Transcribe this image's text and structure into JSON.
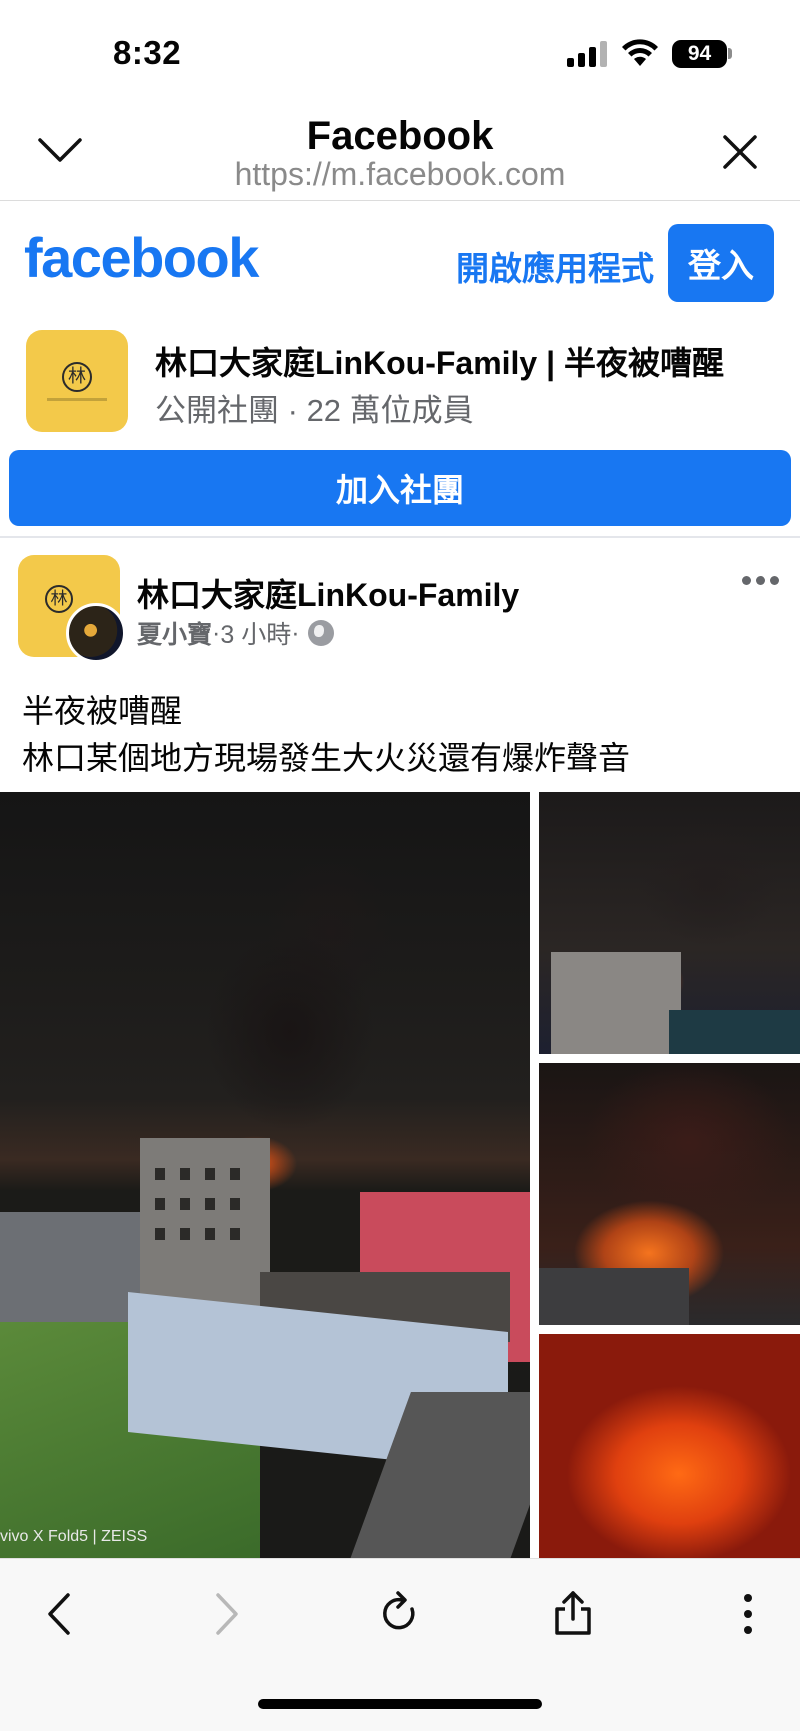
{
  "status_bar": {
    "time": "8:32",
    "battery": "94"
  },
  "browser": {
    "title": "Facebook",
    "url": "https://m.facebook.com",
    "collapse_icon": "chevron-down-icon",
    "close_icon": "close-icon"
  },
  "fb_header": {
    "logo_text": "facebook",
    "open_app_label": "開啟應用程式",
    "login_label": "登入",
    "brand_color": "#1877f2"
  },
  "group": {
    "name": "林口大家庭LinKou-Family | 半夜被嘈醒",
    "type": "公開社團",
    "separator": " · ",
    "members": "22 萬位成員",
    "avatar_glyph": "林",
    "avatar_color": "#f3c94a",
    "join_label": "加入社團"
  },
  "post": {
    "group_name": "林口大家庭LinKou-Family",
    "author": "夏小寶",
    "time": "3 小時",
    "dot": " · ",
    "privacy_icon": "globe-icon",
    "more_icon": "more-dots-icon",
    "text_line1": "半夜被嘈醒",
    "text_line2": "林口某個地方現場發生大火災還有爆炸聲音",
    "photo_watermark": "vivo X Fold5 | ZEISS"
  },
  "toolbar": {
    "back_icon": "back-chevron-icon",
    "forward_icon": "forward-chevron-icon",
    "reload_icon": "reload-icon",
    "share_icon": "share-icon",
    "menu_icon": "more-vertical-icon"
  }
}
